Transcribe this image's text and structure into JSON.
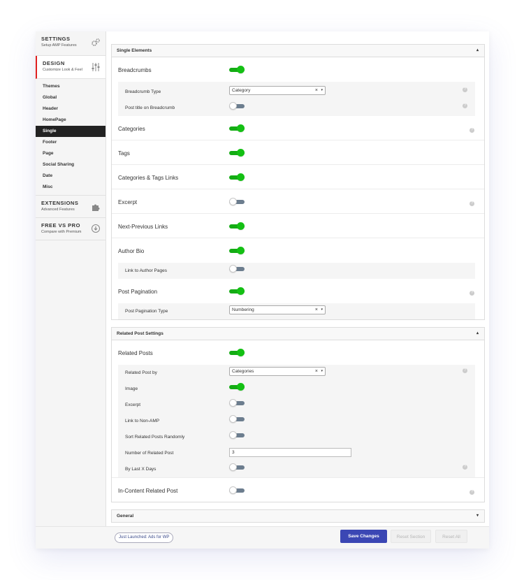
{
  "sidebar": {
    "settings": {
      "title": "SETTINGS",
      "sub": "Setup AMP Features",
      "icon": "gears-icon"
    },
    "design": {
      "title": "DESIGN",
      "sub": "Customize Look & Feel",
      "icon": "sliders-icon"
    },
    "items": [
      "Themes",
      "Global",
      "Header",
      "HomePage",
      "Single",
      "Footer",
      "Page",
      "Social Sharing",
      "Date",
      "Misc"
    ],
    "active": "Single",
    "extensions": {
      "title": "EXTENSIONS",
      "sub": "Advanced Features",
      "icon": "puzzle-icon"
    },
    "freevspro": {
      "title": "FREE VS PRO",
      "sub": "Compare with Premium",
      "icon": "download-icon"
    }
  },
  "single_elements": {
    "title": "Single Elements",
    "breadcrumbs": {
      "label": "Breadcrumbs",
      "on": true
    },
    "breadcrumb_type": {
      "label": "Breadcrumb Type",
      "value": "Category"
    },
    "post_title_on_breadcrumb": {
      "label": "Post title on Breadcrumb",
      "on": false
    },
    "categories": {
      "label": "Categories",
      "on": true
    },
    "tags": {
      "label": "Tags",
      "on": true
    },
    "categories_tags_links": {
      "label": "Categories & Tags Links",
      "on": true
    },
    "excerpt": {
      "label": "Excerpt",
      "on": false
    },
    "next_previous_links": {
      "label": "Next-Previous Links",
      "on": true
    },
    "author_bio": {
      "label": "Author Bio",
      "on": true
    },
    "link_to_author_pages": {
      "label": "Link to Author Pages",
      "on": false
    },
    "post_pagination": {
      "label": "Post Pagination",
      "on": true
    },
    "post_pagination_type": {
      "label": "Post Pagination Type",
      "value": "Numbering"
    }
  },
  "related_posts": {
    "title": "Related Post Settings",
    "related_posts": {
      "label": "Related Posts",
      "on": true
    },
    "related_post_by": {
      "label": "Related Post by",
      "value": "Categories"
    },
    "image": {
      "label": "Image",
      "on": true
    },
    "excerpt": {
      "label": "Excerpt",
      "on": false
    },
    "link_to_non_amp": {
      "label": "Link to Non-AMP",
      "on": false
    },
    "sort_randomly": {
      "label": "Sort Related Posts Randomly",
      "on": false
    },
    "number_of_related_post": {
      "label": "Number of Related Post",
      "value": "3"
    },
    "by_last_x_days": {
      "label": "By Last X Days",
      "on": false
    },
    "in_content_related_post": {
      "label": "In-Content Related Post",
      "on": false
    }
  },
  "general": {
    "title": "General"
  },
  "footer": {
    "promo": "Just Launched: Ads for WP",
    "save": "Save Changes",
    "reset_section": "Reset Section",
    "reset_all": "Reset All"
  },
  "select_clear": "×",
  "select_arrow": "▾",
  "panel_expanded_caret": "▴",
  "panel_collapsed_caret": "▾",
  "help_glyph": "?",
  "colors": {
    "toggle_on": "#14c014",
    "toggle_off": "#6c7d8e",
    "save_button": "#3b47b4",
    "design_accent": "#e02020"
  }
}
